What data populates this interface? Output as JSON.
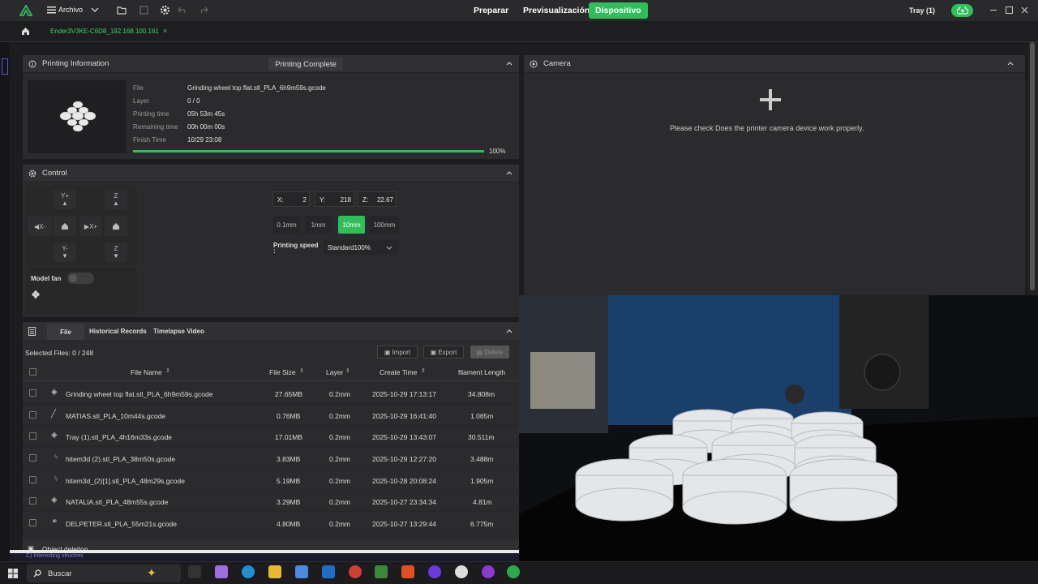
{
  "titlebar": {
    "menu_label": "Archivo",
    "nav": [
      "Preparar",
      "Previsualización",
      "Dispositivo"
    ],
    "tray": "Tray (1)"
  },
  "tabbar": {
    "device_tab": "Ender3V3KE-C6D8_192.168.100.161",
    "close": "×"
  },
  "printing": {
    "title": "Printing Information",
    "status": "Printing Complete",
    "rows": [
      {
        "label": "File",
        "value": "Grinding wheel top flat.stl_PLA_6h9m59s.gcode"
      },
      {
        "label": "Layer",
        "value": "0 / 0"
      },
      {
        "label": "Printing time",
        "value": "05h 53m 45s"
      },
      {
        "label": "Remaining time",
        "value": "00h 00m 00s"
      },
      {
        "label": "Finish Time",
        "value": "10/29 23:08"
      }
    ],
    "progress_label": "100%",
    "progress": 1.0
  },
  "control": {
    "title": "Control",
    "jog": {
      "yplus": "Y+",
      "yminus": "Y-",
      "xminus": "X-",
      "xplus": "X+",
      "z": "Z"
    },
    "coords": {
      "x_label": "X:",
      "x": "2",
      "y_label": "Y:",
      "y": "218",
      "z_label": "Z:",
      "z": "22.67"
    },
    "steps": [
      "0.1mm",
      "1mm",
      "10mm",
      "100mm"
    ],
    "active_step": "10mm",
    "speed_label": "Printing speed",
    "speed_colon": ":",
    "speed_value": "Standard100%",
    "fan_label": "Model fan"
  },
  "files": {
    "tabs": [
      "File",
      "Historical Records",
      "Timelapse Video"
    ],
    "selected": "Selected Files: 0 / 248",
    "import": "Import",
    "export": "Export",
    "delete": "Delete",
    "headers": {
      "name": "File Name",
      "size": "File Size",
      "layer": "Layer",
      "time": "Create Time",
      "length": "filament Length"
    },
    "rows": [
      {
        "name": "Grinding wheel top flat.stl_PLA_6h9m59s.gcode",
        "size": "27.65MB",
        "layer": "0.2mm",
        "time": "2025-10-29 17:13:17",
        "length": "34.808m"
      },
      {
        "name": "MATIAS.stl_PLA_10m44s.gcode",
        "size": "0.76MB",
        "layer": "0.2mm",
        "time": "2025-10-29 16:41:40",
        "length": "1.065m"
      },
      {
        "name": "Tray (1).stl_PLA_4h16m33s.gcode",
        "size": "17.01MB",
        "layer": "0.2mm",
        "time": "2025-10-29 13:43:07",
        "length": "30.511m"
      },
      {
        "name": "hitem3d (2).stl_PLA_38m50s.gcode",
        "size": "3.83MB",
        "layer": "0.2mm",
        "time": "2025-10-29 12:27:20",
        "length": "3.488m"
      },
      {
        "name": "hitem3d_(2)[1].stl_PLA_48m29s.gcode",
        "size": "5.19MB",
        "layer": "0.2mm",
        "time": "2025-10-28 20:08:24",
        "length": "1.905m"
      },
      {
        "name": "NATALIA.stl_PLA_48m55s.gcode",
        "size": "3.29MB",
        "layer": "0.2mm",
        "time": "2025-10-27 23:34:34",
        "length": "4.81m"
      },
      {
        "name": "DELPETER.stl_PLA_55m21s.gcode",
        "size": "4.80MB",
        "layer": "0.2mm",
        "time": "2025-10-27 13:29:44",
        "length": "6.775m"
      }
    ],
    "object_deletion": "Object deletion"
  },
  "camera": {
    "title": "Camera",
    "message": "Please check Does the printer camera device work properly."
  },
  "taskbar": {
    "search": "Buscar",
    "overlay_text": "C) Interesting structres"
  },
  "colors": {
    "accent": "#2fbf5a",
    "panel": "#2b2b2d",
    "header": "#303033"
  }
}
